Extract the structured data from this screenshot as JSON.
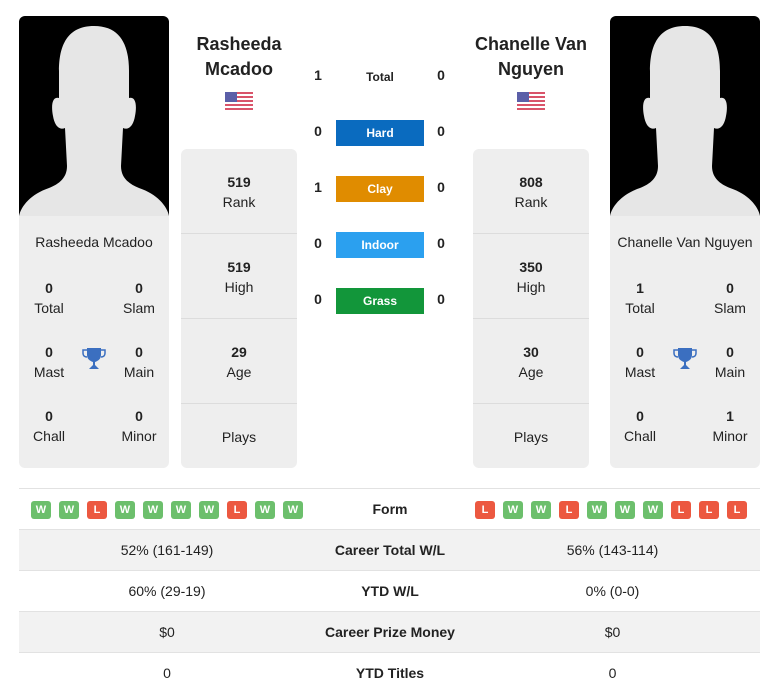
{
  "players": [
    {
      "name": "Rasheeda Mcadoo",
      "name_line1": "Rasheeda",
      "name_line2": "Mcadoo",
      "country_flag": "us-flag-icon",
      "photo": "silhouette-placeholder",
      "titles": {
        "total": {
          "value": "0",
          "label": "Total"
        },
        "slam": {
          "value": "0",
          "label": "Slam"
        },
        "mast": {
          "value": "0",
          "label": "Mast"
        },
        "main": {
          "value": "0",
          "label": "Main"
        },
        "chall": {
          "value": "0",
          "label": "Chall"
        },
        "minor": {
          "value": "0",
          "label": "Minor"
        }
      },
      "rank": {
        "value": "519",
        "label": "Rank"
      },
      "high": {
        "value": "519",
        "label": "High"
      },
      "age": {
        "value": "29",
        "label": "Age"
      },
      "plays": {
        "value": "",
        "label": "Plays"
      },
      "form": [
        "W",
        "W",
        "L",
        "W",
        "W",
        "W",
        "W",
        "L",
        "W",
        "W"
      ]
    },
    {
      "name": "Chanelle Van Nguyen",
      "name_line1": "Chanelle Van",
      "name_line2": "Nguyen",
      "country_flag": "us-flag-icon",
      "photo": "silhouette-placeholder",
      "titles": {
        "total": {
          "value": "1",
          "label": "Total"
        },
        "slam": {
          "value": "0",
          "label": "Slam"
        },
        "mast": {
          "value": "0",
          "label": "Mast"
        },
        "main": {
          "value": "0",
          "label": "Main"
        },
        "chall": {
          "value": "0",
          "label": "Chall"
        },
        "minor": {
          "value": "1",
          "label": "Minor"
        }
      },
      "rank": {
        "value": "808",
        "label": "Rank"
      },
      "high": {
        "value": "350",
        "label": "High"
      },
      "age": {
        "value": "30",
        "label": "Age"
      },
      "plays": {
        "value": "",
        "label": "Plays"
      },
      "form": [
        "L",
        "W",
        "W",
        "L",
        "W",
        "W",
        "W",
        "L",
        "L",
        "L"
      ]
    }
  ],
  "h2h": {
    "total": {
      "label": "Total",
      "p1": "1",
      "p2": "0"
    },
    "surfaces": [
      {
        "label": "Hard",
        "p1": "0",
        "p2": "0",
        "color": "#0a6bbf"
      },
      {
        "label": "Clay",
        "p1": "1",
        "p2": "0",
        "color": "#e08c00"
      },
      {
        "label": "Indoor",
        "p1": "0",
        "p2": "0",
        "color": "#2ba0ef"
      },
      {
        "label": "Grass",
        "p1": "0",
        "p2": "0",
        "color": "#12963a"
      }
    ]
  },
  "comparison": {
    "form_label": "Form",
    "rows": [
      {
        "label": "Career Total W/L",
        "p1": "52% (161-149)",
        "p2": "56% (143-114)"
      },
      {
        "label": "YTD W/L",
        "p1": "60% (29-19)",
        "p2": "0% (0-0)"
      },
      {
        "label": "Career Prize Money",
        "p1": "$0",
        "p2": "$0"
      },
      {
        "label": "YTD Titles",
        "p1": "0",
        "p2": "0"
      }
    ]
  },
  "colors": {
    "win": "#6cbf6c",
    "loss": "#ec5840",
    "trophy": "#3b6fc0",
    "panel": "#eeeeee"
  }
}
